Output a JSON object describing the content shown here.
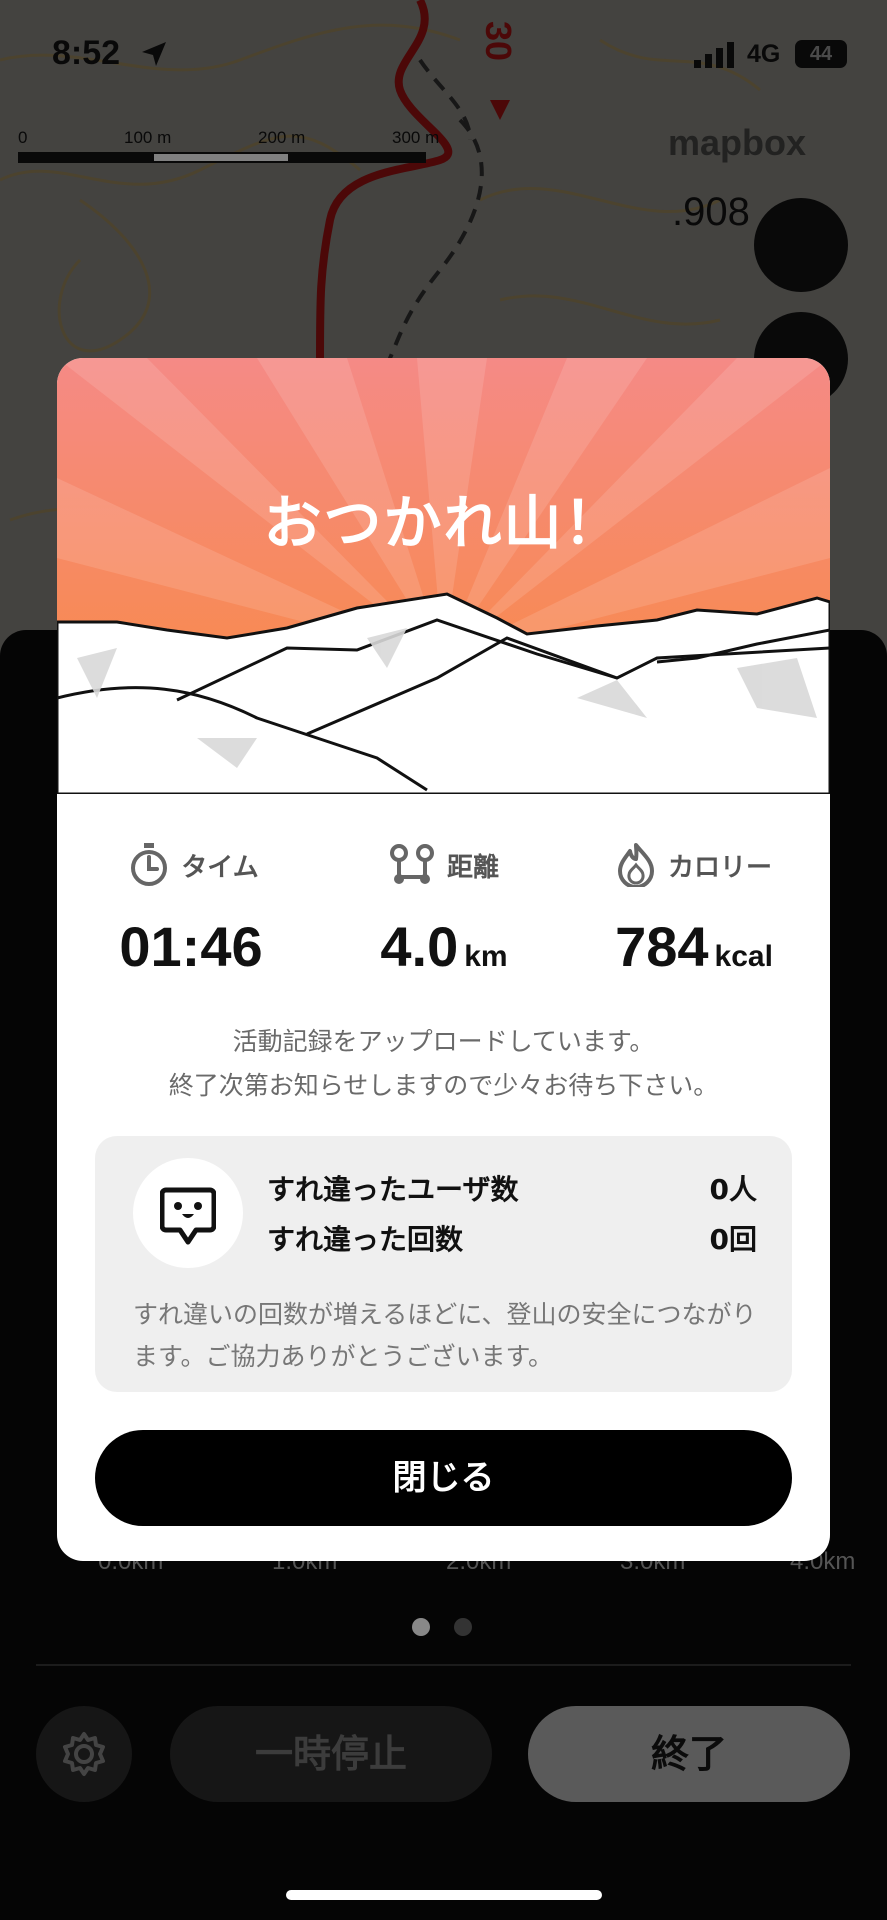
{
  "status_bar": {
    "time": "8:52",
    "network": "4G",
    "battery": "44"
  },
  "map": {
    "scale_labels": [
      "0",
      "100 m",
      "200 m",
      "300 m"
    ],
    "attribution": "mapbox",
    "elevation_label": ".908",
    "route_marker": "30"
  },
  "modal": {
    "title": "おつかれ山！",
    "stats": [
      {
        "icon": "stopwatch-icon",
        "label": "タイム",
        "value": "01:46",
        "unit": ""
      },
      {
        "icon": "route-pin-icon",
        "label": "距離",
        "value": "4.0",
        "unit": "km"
      },
      {
        "icon": "flame-icon",
        "label": "カロリー",
        "value": "784",
        "unit": "kcal"
      }
    ],
    "notice_line1": "活動記録をアップロードしています。",
    "notice_line2": "終了次第お知らせしますので少々お待ち下さい。",
    "passing": {
      "users_label": "すれ違ったユーザ数",
      "users_value": "0人",
      "count_label": "すれ違った回数",
      "count_value": "0回",
      "description": "すれ違いの回数が増えるほどに、登山の安全につながります。ご協力ありがとうございます。"
    },
    "close_label": "閉じる"
  },
  "background_panel": {
    "chart_x_labels": [
      "0.0km",
      "1.0km",
      "2.0km",
      "3.0km",
      "4.0km"
    ],
    "pause_label": "一時停止",
    "end_label": "終了"
  },
  "colors": {
    "banner_top": "#f58a86",
    "banner_bottom": "#f98a3a",
    "primary_button": "#000000"
  }
}
